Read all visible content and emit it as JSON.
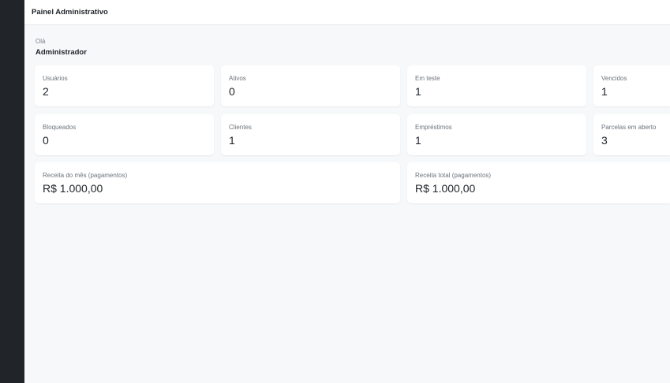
{
  "header": {
    "title": "Painel Administrativo"
  },
  "greeting": {
    "hello": "Olá",
    "name": "Administrador"
  },
  "stats_row1": [
    {
      "label": "Usuários",
      "value": "2"
    },
    {
      "label": "Ativos",
      "value": "0"
    },
    {
      "label": "Em teste",
      "value": "1"
    },
    {
      "label": "Vencidos",
      "value": "1"
    }
  ],
  "stats_row2": [
    {
      "label": "Bloqueados",
      "value": "0"
    },
    {
      "label": "Clientes",
      "value": "1"
    },
    {
      "label": "Empréstimos",
      "value": "1"
    },
    {
      "label": "Parcelas em aberto",
      "value": "3"
    }
  ],
  "revenue": [
    {
      "label": "Receita do mês (pagamentos)",
      "value": "R$ 1.000,00"
    },
    {
      "label": "Receita total (pagamentos)",
      "value": "R$ 1.000,00"
    }
  ]
}
